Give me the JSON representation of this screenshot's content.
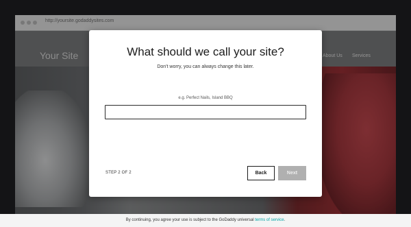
{
  "browser": {
    "url": "http://yoursite.godaddysites.com"
  },
  "site": {
    "title": "Your Site",
    "nav": [
      "About Us",
      "Services"
    ]
  },
  "modal": {
    "title": "What should we call your site?",
    "subtitle": "Don't worry, you can always change this later.",
    "hint": "e.g. Perfect Nails, Island BBQ",
    "input_value": "",
    "step": "STEP 2 OF 2",
    "back_label": "Back",
    "next_label": "Next"
  },
  "footer": {
    "text": "By continuing, you agree your use is subject to the GoDaddy universal ",
    "link": "terms of service",
    "end": "."
  },
  "colors": {
    "accent_link": "#00a4a6",
    "next_disabled": "#b0b0b0"
  }
}
